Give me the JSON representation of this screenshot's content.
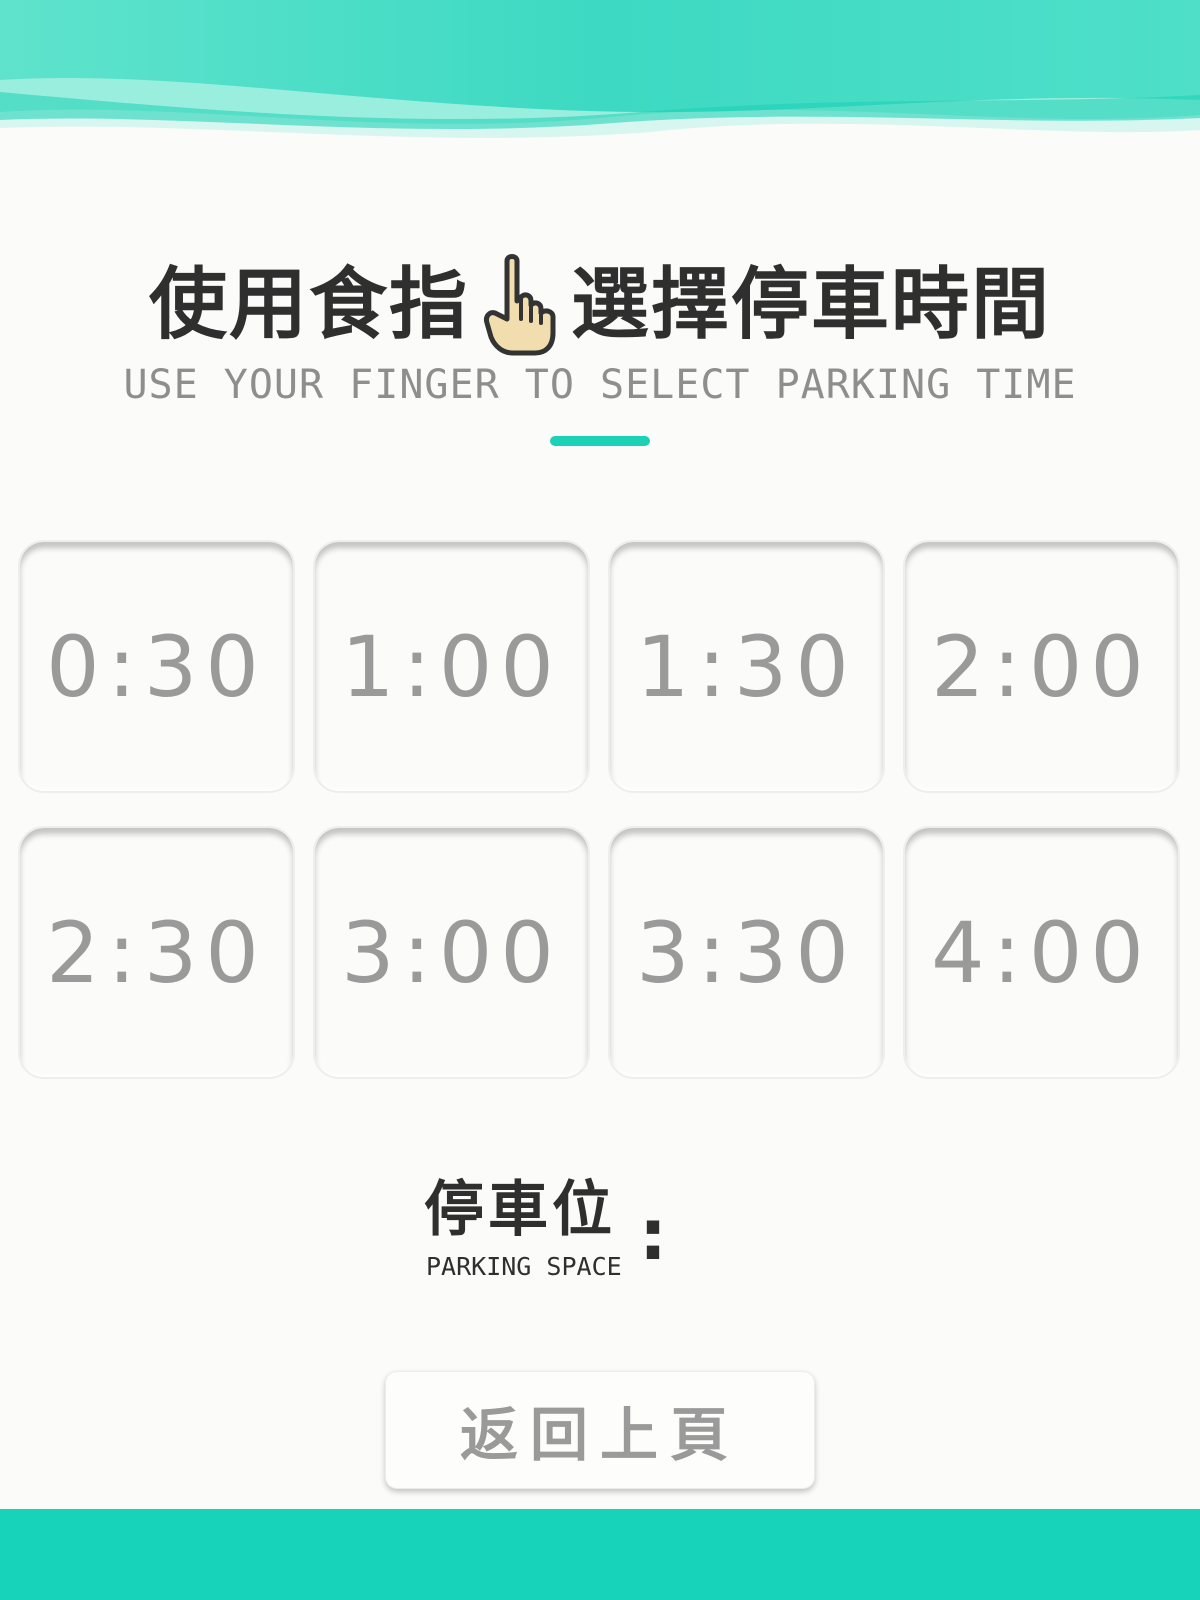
{
  "theme": {
    "accent": "#1dd1b7",
    "footer": "#17d3b9",
    "text_dark": "#2f2f2f",
    "text_muted": "#9a9a9a"
  },
  "header": {
    "title_before": "使用食指",
    "title_after": "選擇停車時間",
    "icon": "pointing-hand-icon",
    "subtitle": "USE YOUR FINGER TO SELECT PARKING TIME"
  },
  "times": [
    "0:30",
    "1:00",
    "1:30",
    "2:00",
    "2:30",
    "3:00",
    "3:30",
    "4:00"
  ],
  "parking": {
    "label_zh": "停車位",
    "label_en": "PARKING SPACE",
    "colon": ":",
    "value": ""
  },
  "back_button": {
    "label": "返回上頁"
  }
}
